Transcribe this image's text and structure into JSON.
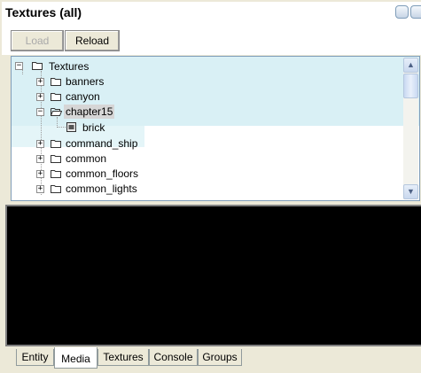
{
  "window": {
    "title": "Textures (all)"
  },
  "toolbar": {
    "load_label": "Load",
    "reload_label": "Reload"
  },
  "tree": {
    "root": {
      "label": "Textures",
      "expanded": true
    },
    "items": [
      {
        "label": "banners",
        "expanded": false
      },
      {
        "label": "canyon",
        "expanded": false
      },
      {
        "label": "chapter15",
        "expanded": true,
        "selected": true
      },
      {
        "label": "brick",
        "type": "file"
      },
      {
        "label": "command_ship",
        "expanded": false
      },
      {
        "label": "common",
        "expanded": false
      },
      {
        "label": "common_floors",
        "expanded": false
      },
      {
        "label": "common_lights",
        "expanded": false
      }
    ]
  },
  "tabs": [
    {
      "label": "Entity"
    },
    {
      "label": "Media",
      "active": true
    },
    {
      "label": "Textures"
    },
    {
      "label": "Console"
    },
    {
      "label": "Groups"
    }
  ],
  "colors": {
    "console_bg": "#000000",
    "panel_bg": "#ece9d8",
    "tree_border": "#7f9db9"
  }
}
